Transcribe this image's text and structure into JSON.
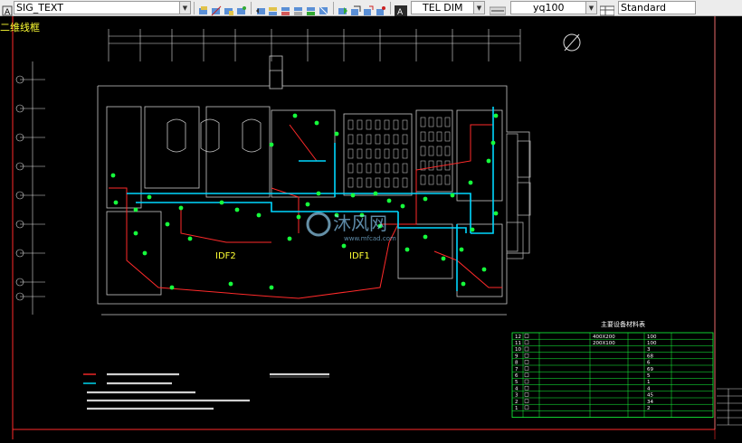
{
  "toolbar": {
    "text_style": "SIG_TEXT",
    "dim_style": "TEL DIM",
    "multileader_style": "yq100",
    "table_style": "Standard"
  },
  "drawing": {
    "title_tab": "二维线框",
    "labels": {
      "idf_left": "IDF2",
      "idf_right": "IDF1",
      "watermark": "沐风网",
      "watermark_url": "www.mfcad.com"
    },
    "axis_labels": [
      "A",
      "B",
      "C",
      "D",
      "E",
      "F",
      "G"
    ]
  },
  "equipment_table": {
    "title": "主要设备材料表",
    "rows": [
      {
        "no": "12",
        "spec": "400X200",
        "qty": "100"
      },
      {
        "no": "11",
        "spec": "200X100",
        "qty": "100"
      },
      {
        "no": "10",
        "spec": "",
        "qty": "3"
      },
      {
        "no": "9",
        "spec": "",
        "qty": "68"
      },
      {
        "no": "8",
        "spec": "",
        "qty": "6"
      },
      {
        "no": "7",
        "spec": "",
        "qty": "69"
      },
      {
        "no": "6",
        "spec": "",
        "qty": "5"
      },
      {
        "no": "5",
        "spec": "",
        "qty": "1"
      },
      {
        "no": "4",
        "spec": "",
        "qty": "4"
      },
      {
        "no": "3",
        "spec": "",
        "qty": "45"
      },
      {
        "no": "2",
        "spec": "",
        "qty": "34"
      },
      {
        "no": "1",
        "spec": "",
        "qty": "2"
      }
    ]
  },
  "legend": {
    "line1_color": "#ff2a2a",
    "line2_color": "#00e5ff"
  },
  "colors": {
    "wall": "#c8c8c8",
    "red": "#ff2a2a",
    "cyan": "#00d8ff",
    "green": "#16ff3c",
    "yellow": "#ffff33"
  }
}
